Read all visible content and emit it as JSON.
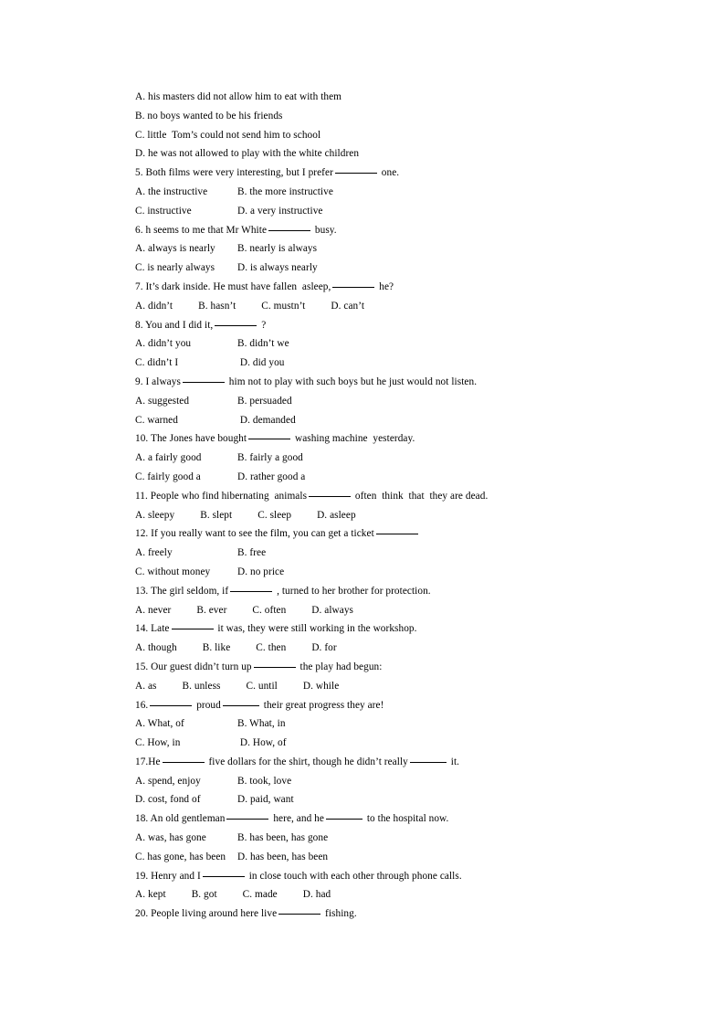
{
  "document": {
    "type": "english-grammar-multiple-choice-worksheet",
    "lines": [
      {
        "id": "l1",
        "kind": "option-line",
        "text": "A. his masters did not allow him to eat with them"
      },
      {
        "id": "l2",
        "kind": "option-line",
        "text": "B. no boys wanted to be his friends"
      },
      {
        "id": "l3",
        "kind": "option-line",
        "text": "C. little  Tom’s could not send him to school"
      },
      {
        "id": "l4",
        "kind": "option-line",
        "text": "D. he was not allowed to play with the white children"
      },
      {
        "id": "l5",
        "kind": "question-line",
        "number": "5.",
        "pre": "5. Both films were very interesting, but I prefer",
        "post": "one."
      },
      {
        "id": "l6",
        "kind": "option-pair",
        "left": "A. the instructive",
        "right": "B. the more instructive"
      },
      {
        "id": "l7",
        "kind": "option-pair",
        "left": "C. instructive",
        "right": "D. a very instructive"
      },
      {
        "id": "l8",
        "kind": "question-line",
        "number": "6.",
        "pre": "6. h seems to me that Mr White",
        "post": "busy."
      },
      {
        "id": "l9",
        "kind": "option-pair",
        "left": "A. always is nearly",
        "right": "B. nearly is always"
      },
      {
        "id": "l10",
        "kind": "option-pair",
        "left": "C. is nearly always",
        "right": "D. is always nearly"
      },
      {
        "id": "l11",
        "kind": "question-line",
        "number": "7.",
        "pre": "7. It’s dark inside. He must have fallen  asleep,",
        "post": "he?"
      },
      {
        "id": "l12",
        "kind": "option-quad",
        "a": "A. didn’t",
        "b": "B. hasn’t",
        "c": "C. mustn’t",
        "d": "D. can’t"
      },
      {
        "id": "l13",
        "kind": "question-line",
        "number": "8.",
        "pre": "8. You and I did it,",
        "post": "?"
      },
      {
        "id": "l14",
        "kind": "option-pair",
        "left": "A. didn’t you",
        "right": "B. didn’t we"
      },
      {
        "id": "l15",
        "kind": "option-pair",
        "left": "C. didn’t I",
        "right": " D. did you"
      },
      {
        "id": "l16",
        "kind": "question-line",
        "number": "9.",
        "pre": "9. I always",
        "post": "him not to play with such boys but he just would not listen."
      },
      {
        "id": "l17",
        "kind": "option-pair",
        "left": "A. suggested",
        "right": "B. persuaded"
      },
      {
        "id": "l18",
        "kind": "option-pair",
        "left": "C. warned",
        "right": " D. demanded"
      },
      {
        "id": "l19",
        "kind": "question-line",
        "number": "10.",
        "pre": "10. The Jones have bought",
        "post": "washing machine  yesterday."
      },
      {
        "id": "l20",
        "kind": "option-pair",
        "left": "A. a fairly good",
        "right": "B. fairly a good"
      },
      {
        "id": "l21",
        "kind": "option-pair",
        "left": "C. fairly good a",
        "right": "D. rather good a"
      },
      {
        "id": "l22",
        "kind": "question-line",
        "number": "11.",
        "pre": "11. People who find hibernating  animals",
        "post": "often  think  that  they are dead."
      },
      {
        "id": "l23",
        "kind": "option-quad",
        "a": "A. sleepy",
        "b": "B. slept",
        "c": "C. sleep",
        "d": "D. asleep"
      },
      {
        "id": "l24",
        "kind": "question-trailing-blank",
        "number": "12.",
        "pre": "12. If you really want to see the film, you can get a ticket"
      },
      {
        "id": "l25",
        "kind": "option-pair",
        "left": "A. freely",
        "right": "B. free"
      },
      {
        "id": "l26",
        "kind": "option-pair",
        "left": "C. without money",
        "right": "D. no price"
      },
      {
        "id": "l27",
        "kind": "question-line",
        "number": "13.",
        "pre": "13. The girl seldom, if",
        "post": ", turned to her brother for protection."
      },
      {
        "id": "l28",
        "kind": "option-quad",
        "a": "A. never",
        "b": "B. ever",
        "c": "C. often",
        "d": "D. always"
      },
      {
        "id": "l29",
        "kind": "question-line",
        "number": "14.",
        "pre": "14. Late",
        "post": "it was, they were still working in the workshop."
      },
      {
        "id": "l30",
        "kind": "option-quad",
        "a": "A. though",
        "b": "B. like",
        "c": "C. then",
        "d": "D. for"
      },
      {
        "id": "l31",
        "kind": "question-line",
        "number": "15.",
        "pre": "15. Our guest didn’t turn up",
        "post": "the play had begun:"
      },
      {
        "id": "l32",
        "kind": "option-quad",
        "a": "A. as",
        "b": "B. unless",
        "c": "C. until",
        "d": "D. while"
      },
      {
        "id": "l33",
        "kind": "question-two-blanks",
        "number": "16.",
        "pre": "16.",
        "mid": "proud",
        "post": "their great progress they are!"
      },
      {
        "id": "l34",
        "kind": "option-pair",
        "left": "A. What, of",
        "right": "B. What, in"
      },
      {
        "id": "l35",
        "kind": "option-pair",
        "left": "C. How, in",
        "right": " D. How, of"
      },
      {
        "id": "l36",
        "kind": "question-two-blanks",
        "number": "17.",
        "pre": "17.He",
        "mid": "five dollars for the shirt, though he didn’t really",
        "post": "it."
      },
      {
        "id": "l37",
        "kind": "option-pair",
        "left": "A. spend, enjoy",
        "right": "B. took, love"
      },
      {
        "id": "l38",
        "kind": "option-pair",
        "left": "D. cost, fond of",
        "right": "D. paid, want"
      },
      {
        "id": "l39",
        "kind": "question-two-blanks",
        "number": "18.",
        "pre": "18. An old gentleman",
        "mid": "here, and he",
        "post": "to the hospital now."
      },
      {
        "id": "l40",
        "kind": "option-pair",
        "left": "A. was, has gone",
        "right": "B. has been, has gone"
      },
      {
        "id": "l41",
        "kind": "option-pair",
        "left": "C. has gone, has been",
        "right": "D. has been, has been"
      },
      {
        "id": "l42",
        "kind": "question-line",
        "number": "19.",
        "pre": "19. Henry and I",
        "post": "in close touch with each other through phone calls."
      },
      {
        "id": "l43",
        "kind": "option-quad",
        "a": "A. kept",
        "b": "B. got",
        "c": "C. made",
        "d": "D. had"
      },
      {
        "id": "l44",
        "kind": "question-line",
        "number": "20.",
        "pre": "20. People living around here live",
        "post": "fishing."
      }
    ]
  }
}
